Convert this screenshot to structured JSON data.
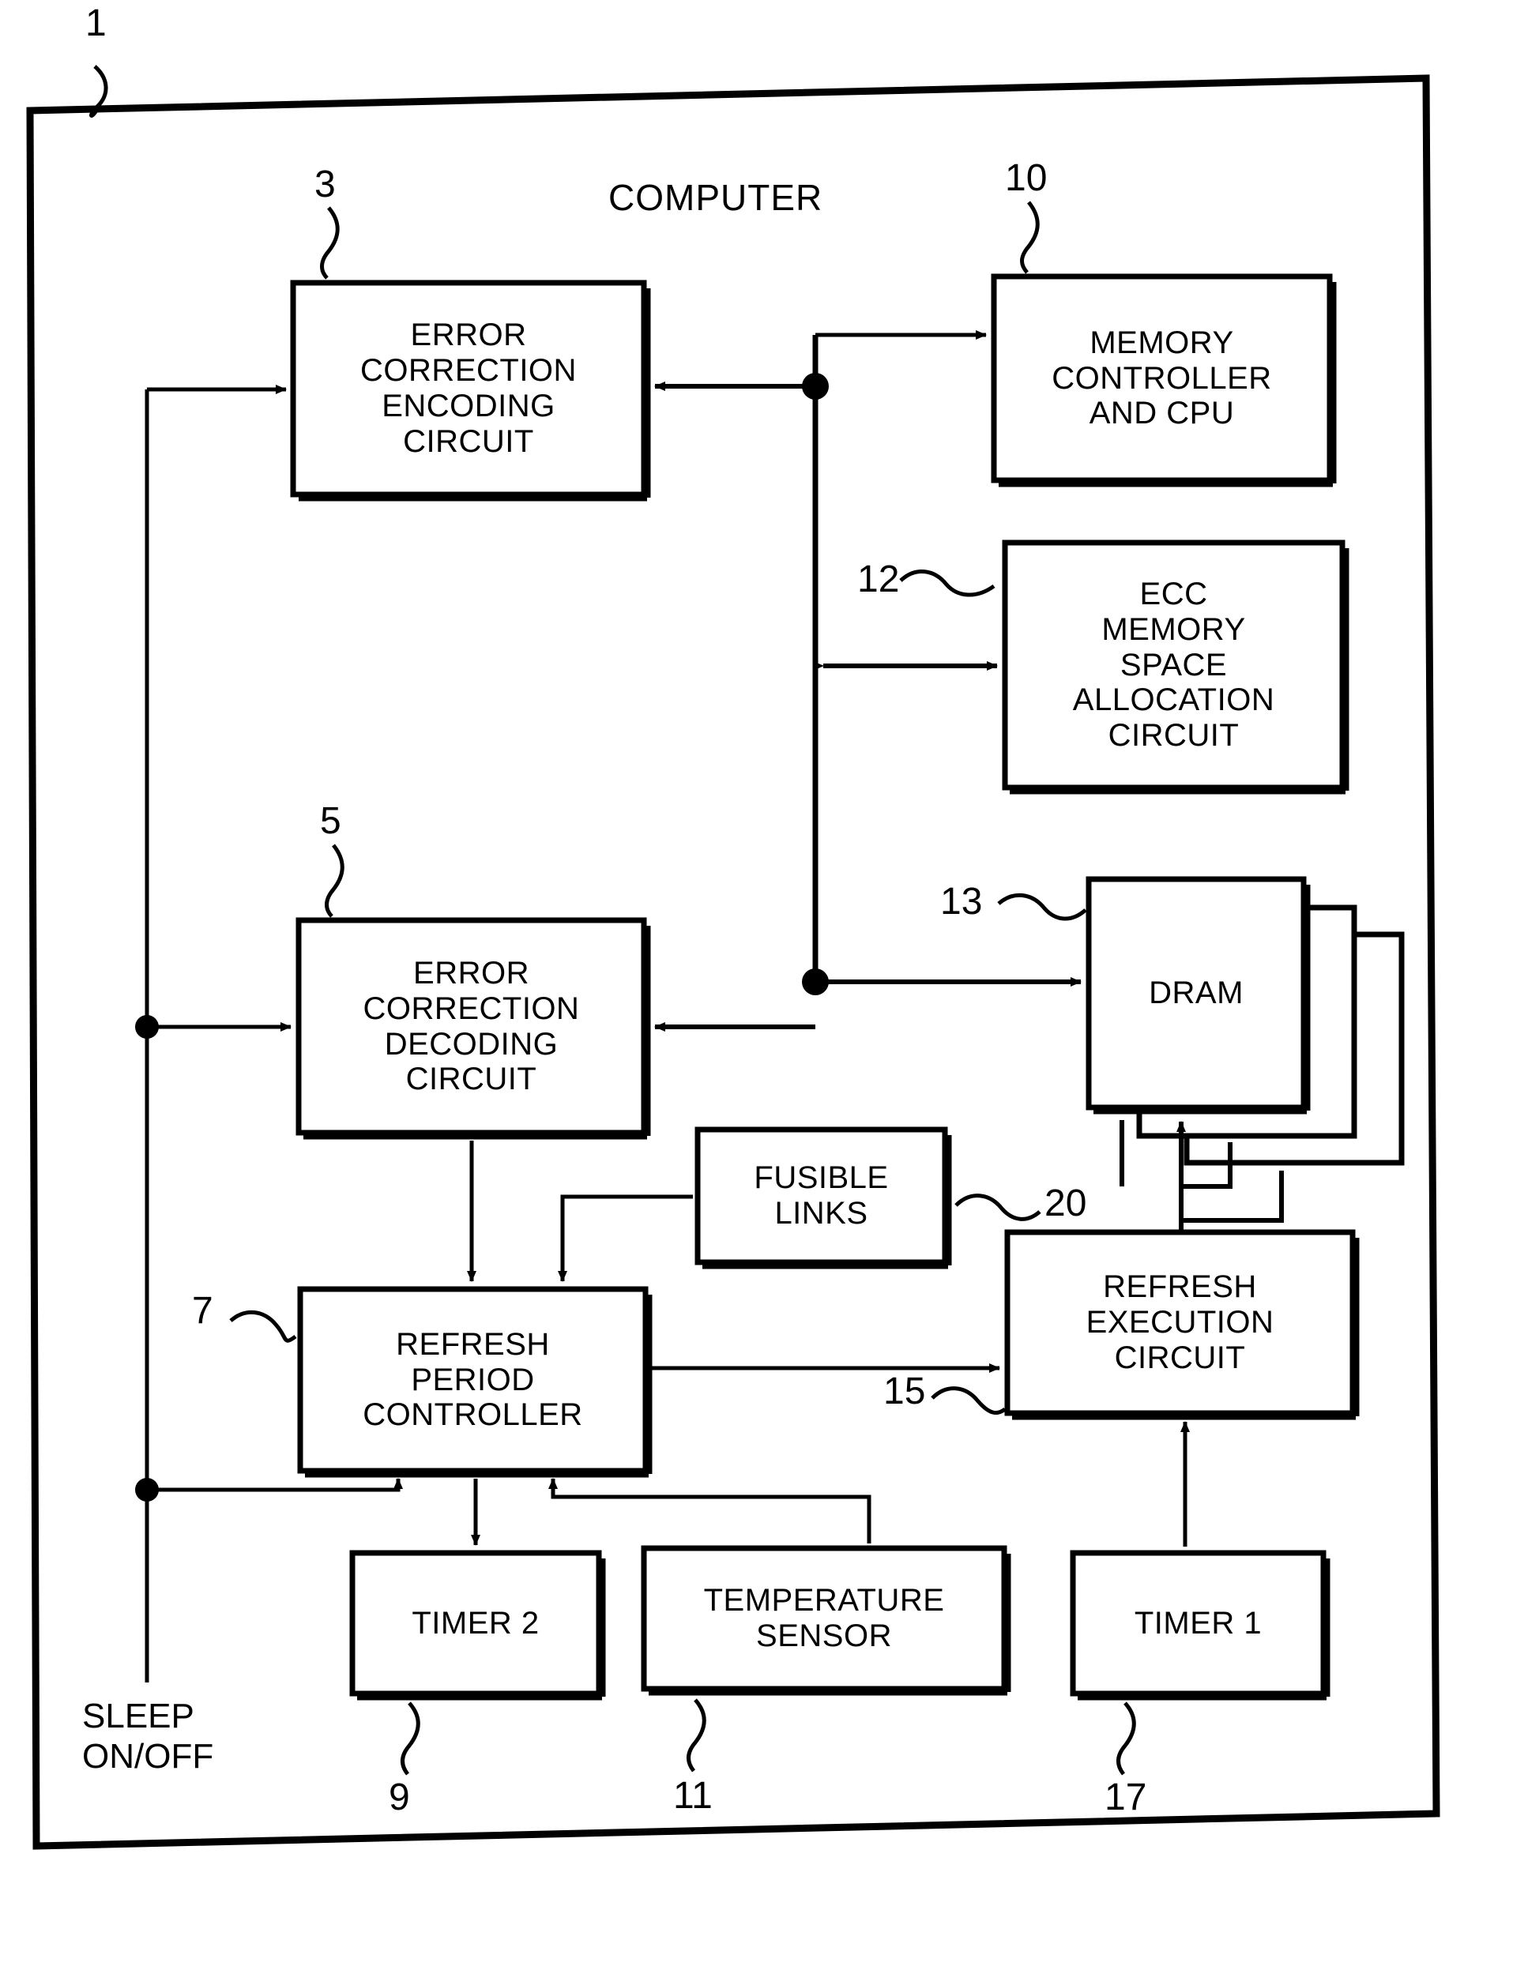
{
  "figure": {
    "title": "COMPUTER",
    "outer_ref": "1",
    "external_signal_label": "SLEEP\nON/OFF"
  },
  "blocks": [
    {
      "id": "error-correction-encoding-circuit",
      "label": "ERROR\nCORRECTION\nENCODING\nCIRCUIT",
      "ref": "3"
    },
    {
      "id": "memory-controller-and-cpu",
      "label": "MEMORY\nCONTROLLER\nAND CPU",
      "ref": "10"
    },
    {
      "id": "ecc-memory-space-allocation-circuit",
      "label": "ECC\nMEMORY\nSPACE\nALLOCATION\nCIRCUIT",
      "ref": "12"
    },
    {
      "id": "error-correction-decoding-circuit",
      "label": "ERROR\nCORRECTION\nDECODING\nCIRCUIT",
      "ref": "5"
    },
    {
      "id": "dram",
      "label": "DRAM",
      "ref": "13"
    },
    {
      "id": "fusible-links",
      "label": "FUSIBLE\nLINKS",
      "ref": "20"
    },
    {
      "id": "refresh-period-controller",
      "label": "REFRESH\nPERIOD\nCONTROLLER",
      "ref": "7"
    },
    {
      "id": "refresh-execution-circuit",
      "label": "REFRESH\nEXECUTION\nCIRCUIT",
      "ref": "15"
    },
    {
      "id": "timer-2",
      "label": "TIMER 2",
      "ref": "9"
    },
    {
      "id": "temperature-sensor",
      "label": "TEMPERATURE\nSENSOR",
      "ref": "11"
    },
    {
      "id": "timer-1",
      "label": "TIMER 1",
      "ref": "17"
    }
  ],
  "colors": {
    "ink": "#000000",
    "paper": "#ffffff"
  }
}
